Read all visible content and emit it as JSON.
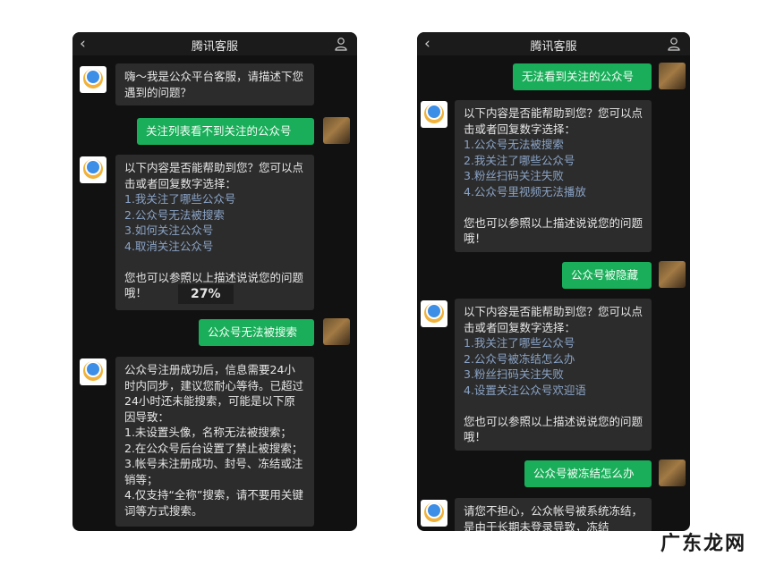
{
  "left": {
    "title": "腾讯客服",
    "messages": [
      {
        "from": "bot",
        "text": "嗨～我是公众平台客服，请描述下您遇到的问题？"
      },
      {
        "from": "user",
        "text": "关注列表看不到关注的公众号"
      },
      {
        "from": "bot",
        "intro": "以下内容是否能帮助到您？您可以点击或者回复数字选择：",
        "options": [
          "1.我关注了哪些公众号",
          "2.公众号无法被搜索",
          "3.如何关注公众号",
          "4.取消关注公众号"
        ],
        "outro": "您也可以参照以上描述说说您的问题哦！"
      },
      {
        "from": "user",
        "text": "公众号无法被搜索"
      },
      {
        "from": "bot",
        "text": "公众号注册成功后，信息需要24小时内同步，建议您耐心等待。已超过24小时还未能搜索，可能是以下原因导致：\n1.未设置头像，名称无法被搜索；\n2.在公众号后台设置了禁止被搜索；\n3.帐号未注册成功、封号、冻结或注销等；\n4.仅支持“全称”搜索，请不要用关键词等方式搜索。"
      }
    ],
    "progress_label": "27%"
  },
  "right": {
    "title": "腾讯客服",
    "messages": [
      {
        "from": "user",
        "text": "无法看到关注的公众号"
      },
      {
        "from": "bot",
        "intro": "以下内容是否能帮助到您？您可以点击或者回复数字选择：",
        "options": [
          "1.公众号无法被搜索",
          "2.我关注了哪些公众号",
          "3.粉丝扫码关注失败",
          "4.公众号里视频无法播放"
        ],
        "outro": "您也可以参照以上描述说说您的问题哦！"
      },
      {
        "from": "user",
        "text": "公众号被隐藏"
      },
      {
        "from": "bot",
        "intro": "以下内容是否能帮助到您？您可以点击或者回复数字选择：",
        "options": [
          "1.我关注了哪些公众号",
          "2.公众号被冻结怎么办",
          "3.粉丝扫码关注失败",
          "4.设置关注公众号欢迎语"
        ],
        "outro": "您也可以参照以上描述说说您的问题哦！"
      },
      {
        "from": "user",
        "text": "公众号被冻结怎么办"
      },
      {
        "from": "bot",
        "text": "请您不担心，公众帐号被系统冻结，是由于长期未登录导致，冻结"
      }
    ]
  },
  "watermark": "广东龙网",
  "icons": {
    "back": "chevron-left-icon",
    "profile": "person-icon",
    "bot_avatar": "service-bot-avatar",
    "user_avatar": "user-avatar"
  }
}
